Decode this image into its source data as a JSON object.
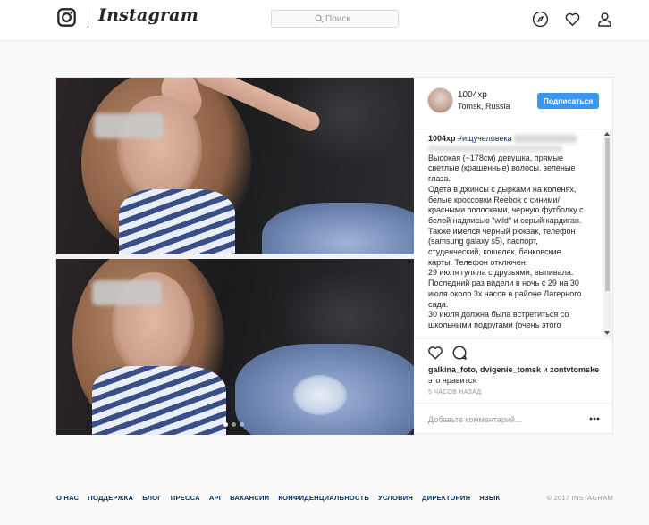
{
  "header": {
    "brand": "Instagram",
    "search_placeholder": "Поиск",
    "icons": [
      "instagram-logo-icon",
      "compass-icon",
      "heart-icon",
      "person-icon"
    ]
  },
  "post": {
    "username": "1004xp",
    "location": "Tomsk, Russia",
    "follow_label": "Подписаться",
    "caption": {
      "user": "1004xp",
      "tag": "#ищучеловека",
      "lines": [
        "Высокая (~178см) девушка, прямые",
        "светлые (крашенные) волосы, зеленые",
        "глаза.",
        "Одета в джинсы с дырками на коленях,",
        "белые кроссовки Reebok с синими/",
        "красными полосками, черную футболку с",
        "белой надписью \"wild\" и серый кардиган.",
        "Также имелся черный рюкзак, телефон",
        "(samsung galaxy s5), паспорт,",
        "студенческий, кошелек, банковские",
        "карты. Телефон отключен.",
        "29 июля гуляла с друзьями, выпивала.",
        "Последний раз видели в ночь с 29 на 30",
        "июля около 3х часов в районе Лагерного",
        "сада.",
        "30 июля должна была встретиться со",
        "школьными подругами (очень этого"
      ]
    },
    "likes": {
      "users": "galkina_foto, dvigenie_tomsk",
      "conj": " и ",
      "last_user": "zontvtomske",
      "suffix": "это нравится"
    },
    "time_ago": "5 ЧАСОВ НАЗАД",
    "comment_placeholder": "Добавьте комментарий...",
    "carousel_count": 3,
    "carousel_active": 0
  },
  "footer": {
    "links": [
      "О НАС",
      "ПОДДЕРЖКА",
      "БЛОГ",
      "ПРЕССА",
      "API",
      "ВАКАНСИИ",
      "КОНФИДЕНЦИАЛЬНОСТЬ",
      "УСЛОВИЯ",
      "ДИРЕКТОРИЯ",
      "ЯЗЫК"
    ],
    "copyright": "© 2017 INSTAGRAM"
  },
  "colors": {
    "accent": "#3897f0",
    "link": "#003569",
    "text": "#262626",
    "muted": "#999999",
    "background": "#fafafa"
  }
}
